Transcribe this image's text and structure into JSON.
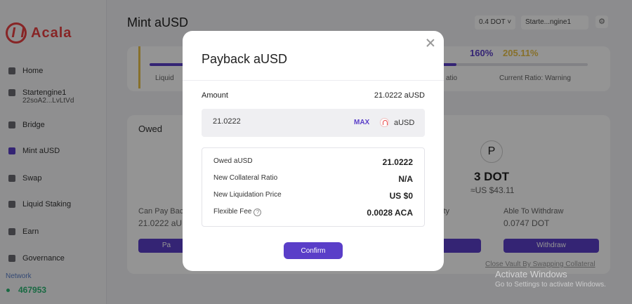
{
  "brand": {
    "name": "Acala"
  },
  "sidebar": {
    "items": [
      {
        "label": "Home"
      },
      {
        "label": "Startengine1",
        "sub": "22soA2...LvLtVd"
      },
      {
        "label": "Bridge"
      },
      {
        "label": "Mint aUSD"
      },
      {
        "label": "Swap"
      },
      {
        "label": "Liquid Staking"
      },
      {
        "label": "Earn"
      },
      {
        "label": "Governance"
      }
    ],
    "network_label": "Network",
    "block_number": "467953"
  },
  "main": {
    "title": "Mint aUSD",
    "balance_pill": "0.4 DOT ˅",
    "account_pill": "Starte...ngine1",
    "ratio_min": "160%",
    "ratio_current": "205.11%",
    "legend_left": "Liquid",
    "legend_mid": "atio",
    "legend_right": "Current Ratio: Warning",
    "owed_title": "Owed",
    "collateral_amount": "3 DOT",
    "collateral_usd": "≈US $43.11",
    "can_pay_back_label": "Can Pay Back",
    "can_pay_back_value": "21.0222 aU",
    "mid_label": "ity",
    "able_withdraw_label": "Able To Withdraw",
    "able_withdraw_value": "0.0747 DOT",
    "pay_btn": "Pa",
    "withdraw_btn": "Withdraw",
    "close_vault_link": "Close Vault By Swapping Collateral"
  },
  "watermark": {
    "title": "Activate Windows",
    "subtitle": "Go to Settings to activate Windows."
  },
  "modal": {
    "title": "Payback aUSD",
    "amount_label": "Amount",
    "amount_value": "21.0222 aUSD",
    "input_value": "21.0222",
    "max_label": "MAX",
    "token": "aUSD",
    "rows": [
      {
        "label": "Owed aUSD",
        "value": "21.0222"
      },
      {
        "label": "New Collateral Ratio",
        "value": "N/A"
      },
      {
        "label": "New Liquidation Price",
        "value": "US $0"
      },
      {
        "label": "Flexible Fee",
        "value": "0.0028 ACA"
      }
    ],
    "confirm_label": "Confirm"
  }
}
